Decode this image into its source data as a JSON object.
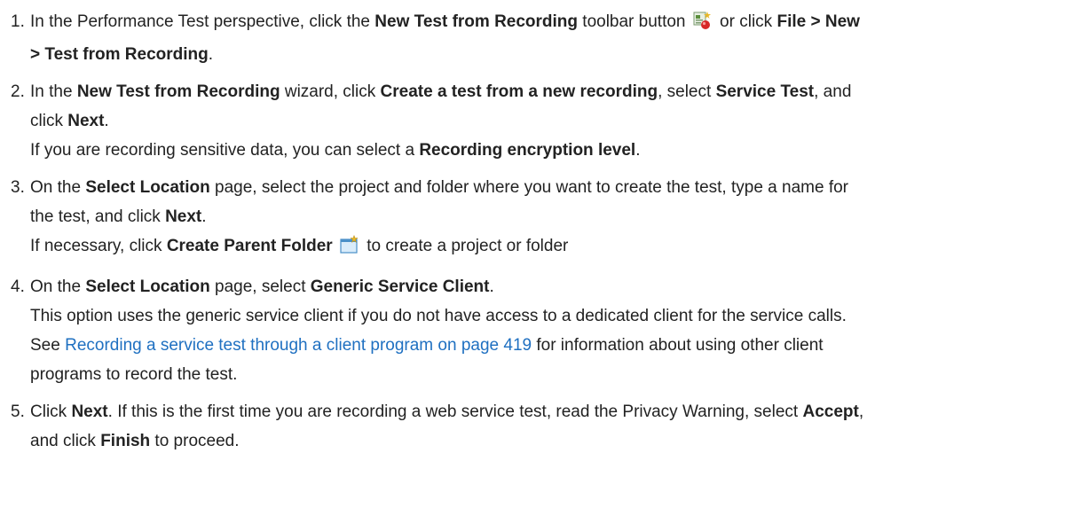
{
  "steps": [
    {
      "number": "1.",
      "lines": [
        {
          "segments": [
            {
              "t": "In the Performance Test perspective, click the "
            },
            {
              "t": "New Test from Recording",
              "b": true
            },
            {
              "t": " toolbar button "
            },
            {
              "icon": "new-test-from-recording-icon"
            },
            {
              "t": " or click "
            },
            {
              "t": "File > New",
              "b": true
            }
          ]
        },
        {
          "segments": [
            {
              "t": "> Test from Recording",
              "b": true
            },
            {
              "t": "."
            }
          ]
        }
      ]
    },
    {
      "number": "2.",
      "lines": [
        {
          "segments": [
            {
              "t": "In the "
            },
            {
              "t": "New Test from Recording",
              "b": true
            },
            {
              "t": " wizard, click "
            },
            {
              "t": "Create a test from a new recording",
              "b": true
            },
            {
              "t": ", select "
            },
            {
              "t": "Service Test",
              "b": true
            },
            {
              "t": ", and"
            }
          ]
        },
        {
          "segments": [
            {
              "t": "click "
            },
            {
              "t": "Next",
              "b": true
            },
            {
              "t": "."
            }
          ]
        },
        {
          "segments": [
            {
              "t": "If you are recording sensitive data, you can select a "
            },
            {
              "t": "Recording encryption level",
              "b": true
            },
            {
              "t": "."
            }
          ]
        }
      ]
    },
    {
      "number": "3.",
      "lines": [
        {
          "segments": [
            {
              "t": "On the "
            },
            {
              "t": "Select Location",
              "b": true
            },
            {
              "t": " page, select the project and folder where you want to create the test, type a name for"
            }
          ]
        },
        {
          "segments": [
            {
              "t": "the test, and click "
            },
            {
              "t": "Next",
              "b": true
            },
            {
              "t": "."
            }
          ]
        },
        {
          "segments": [
            {
              "t": "If necessary, click "
            },
            {
              "t": "Create Parent Folder",
              "b": true
            },
            {
              "t": " "
            },
            {
              "icon": "create-parent-folder-icon"
            },
            {
              "t": " to create a project or folder"
            }
          ]
        }
      ]
    },
    {
      "number": "4.",
      "lines": [
        {
          "segments": [
            {
              "t": "On the "
            },
            {
              "t": "Select Location",
              "b": true
            },
            {
              "t": " page, select "
            },
            {
              "t": "Generic Service Client",
              "b": true
            },
            {
              "t": "."
            }
          ]
        },
        {
          "segments": [
            {
              "t": "This option uses the generic service client if you do not have access to a dedicated client for the service calls."
            }
          ]
        },
        {
          "segments": [
            {
              "t": "See "
            },
            {
              "t": "Recording a service test through a client program on page 419",
              "link": true
            },
            {
              "t": " for information about using other client"
            }
          ]
        },
        {
          "segments": [
            {
              "t": "programs to record the test."
            }
          ]
        }
      ]
    },
    {
      "number": "5.",
      "lines": [
        {
          "segments": [
            {
              "t": "Click "
            },
            {
              "t": "Next",
              "b": true
            },
            {
              "t": ". If this is the first time you are recording a web service test, read the Privacy Warning, select "
            },
            {
              "t": "Accept",
              "b": true
            },
            {
              "t": ","
            }
          ]
        },
        {
          "segments": [
            {
              "t": "and click "
            },
            {
              "t": "Finish",
              "b": true
            },
            {
              "t": " to proceed."
            }
          ]
        }
      ]
    }
  ],
  "colors": {
    "text": "#222222",
    "link": "#1f70c1"
  }
}
